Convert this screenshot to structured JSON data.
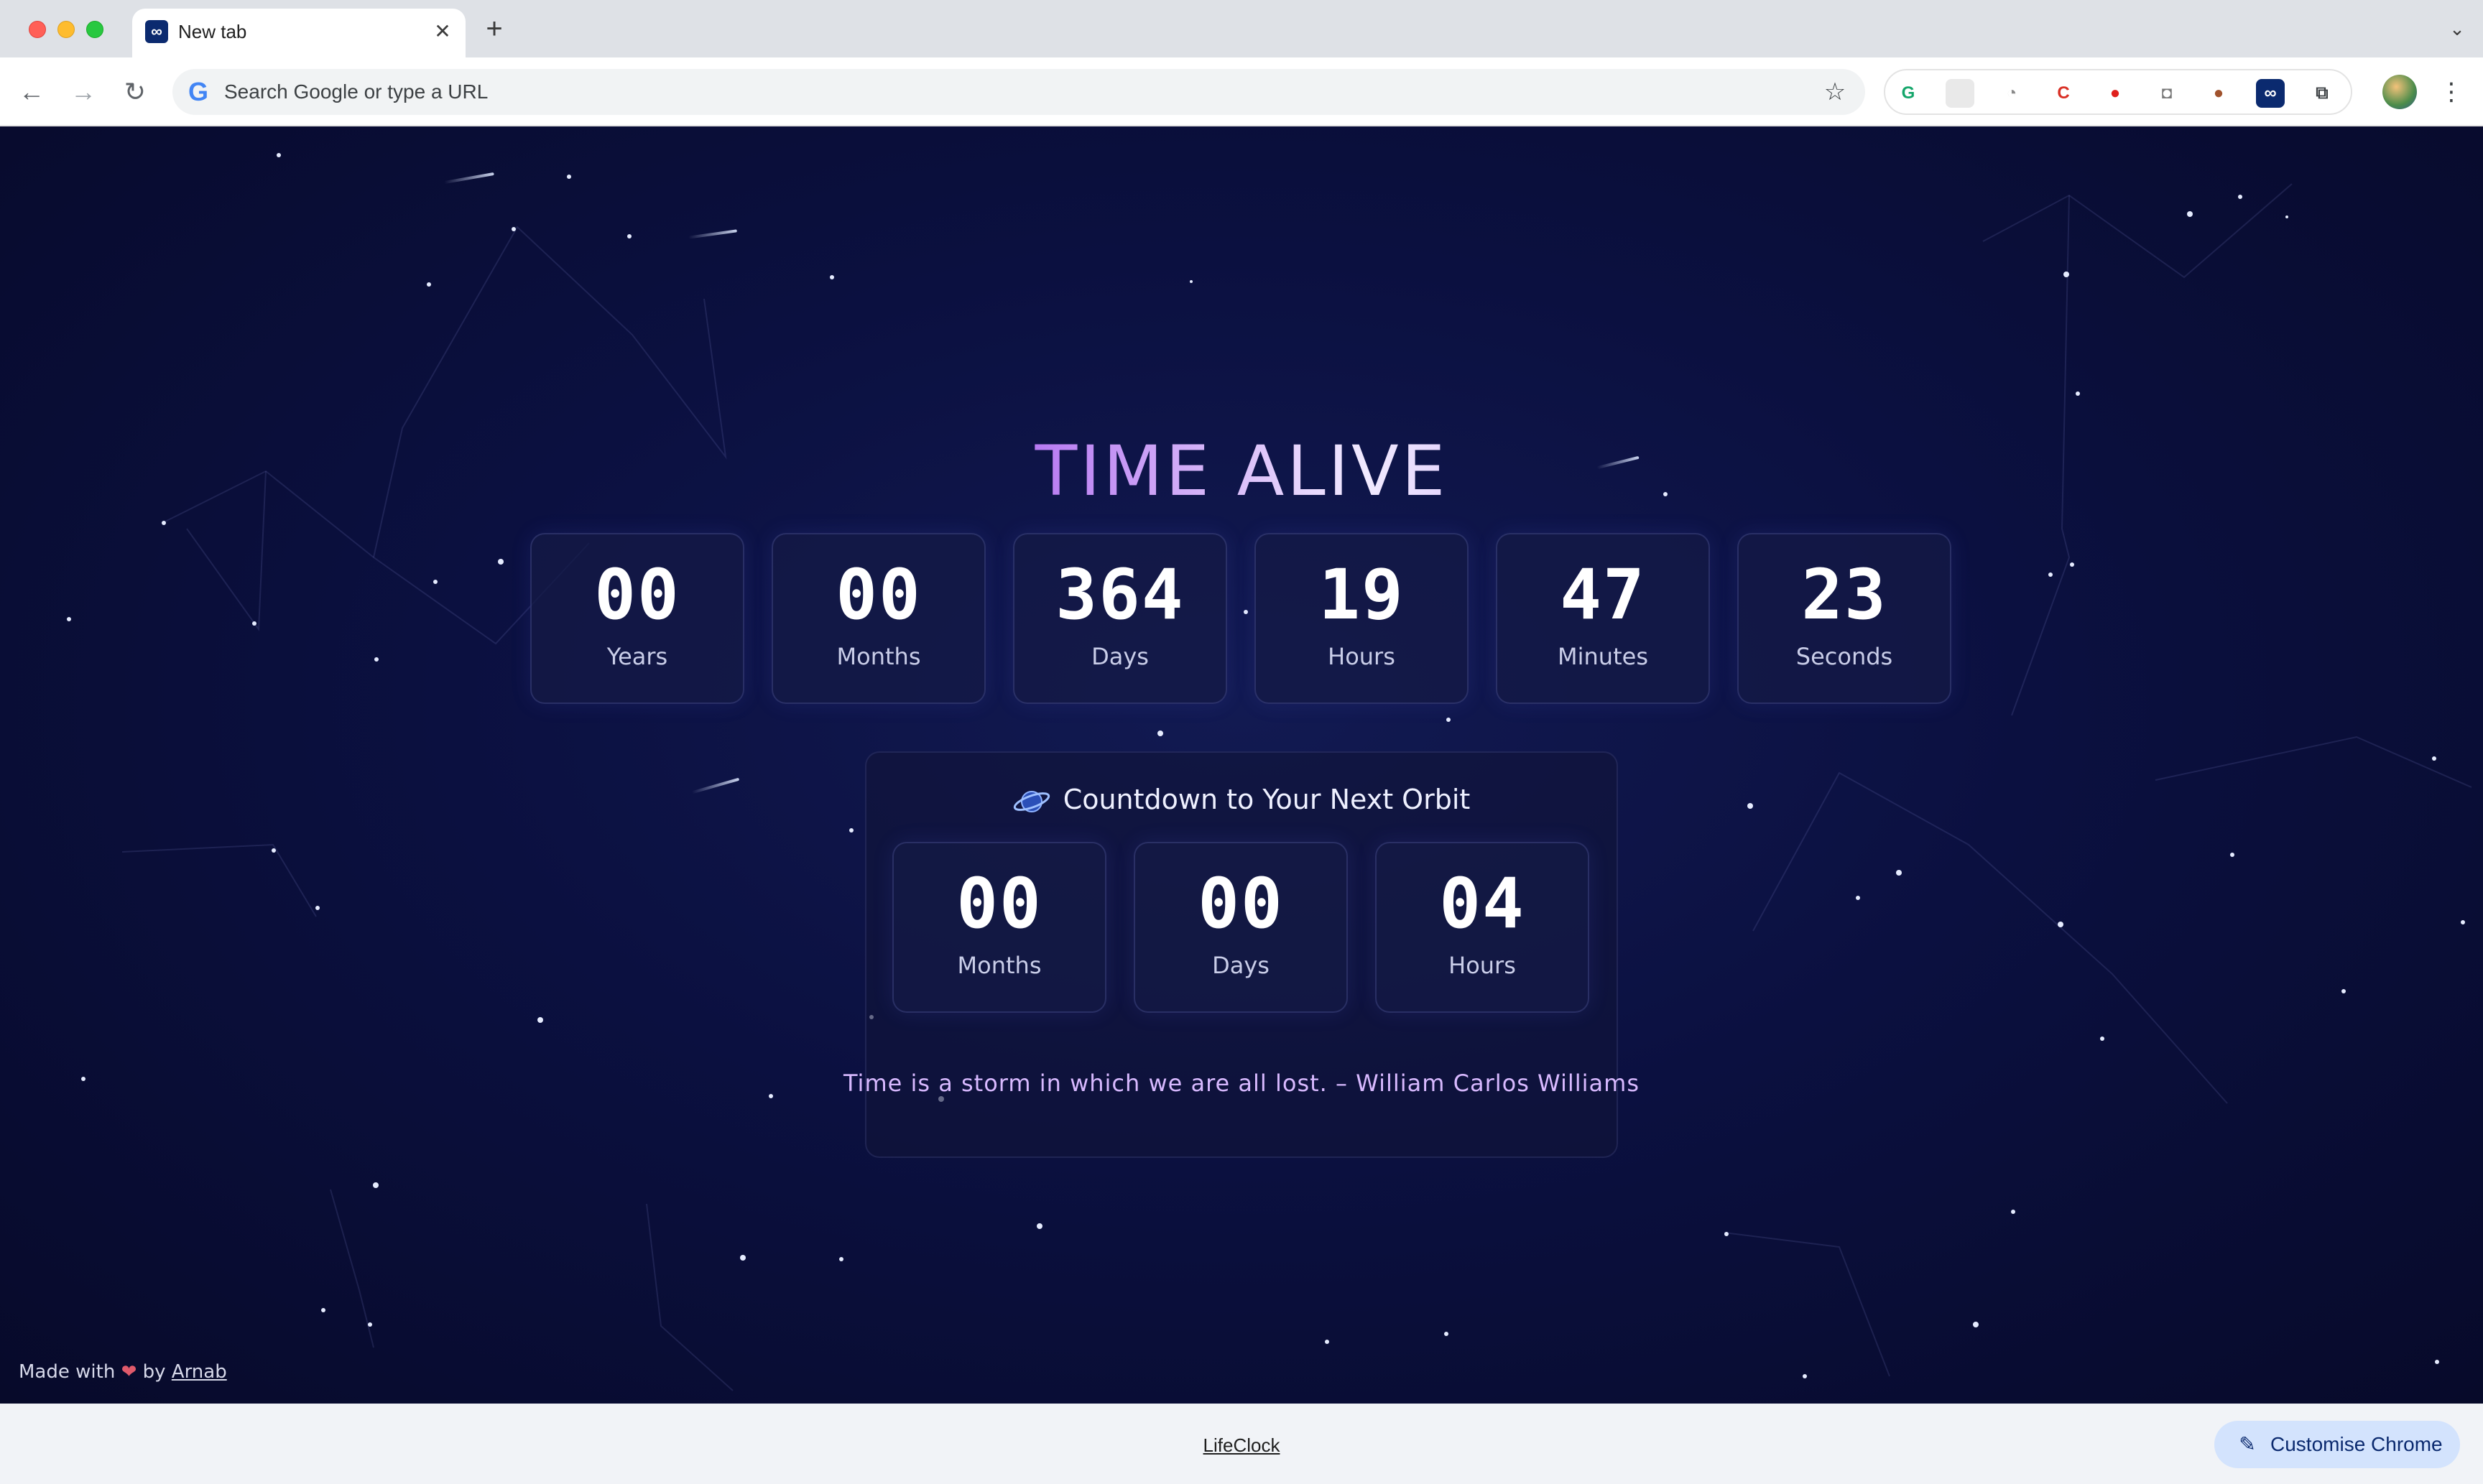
{
  "browser": {
    "tab_title": "New tab",
    "tab_close": "✕",
    "new_tab": "+",
    "tab_search": "⌄",
    "omnibox_placeholder": "Search Google or type a URL",
    "extensions": [
      "grammarly-icon",
      "blank-extension-icon",
      "clock-extension-icon",
      "code-extension-icon",
      "opera-icon",
      "camera-icon",
      "cookie-icon",
      "lifeclock-icon",
      "puzzle-icon"
    ]
  },
  "app": {
    "title": "TIME ALIVE",
    "elapsed": [
      {
        "value": "00",
        "label": "Years"
      },
      {
        "value": "00",
        "label": "Months"
      },
      {
        "value": "364",
        "label": "Days"
      },
      {
        "value": "19",
        "label": "Hours"
      },
      {
        "value": "47",
        "label": "Minutes"
      },
      {
        "value": "23",
        "label": "Seconds"
      }
    ],
    "countdown": {
      "heading": "Countdown to Your Next Orbit",
      "items": [
        {
          "value": "00",
          "label": "Months"
        },
        {
          "value": "00",
          "label": "Days"
        },
        {
          "value": "04",
          "label": "Hours"
        }
      ]
    },
    "quote": "Time is a storm in which we are all lost. – William Carlos Williams",
    "footer_credit": {
      "prefix": "Made with",
      "heart": "❤",
      "by": "by",
      "author": "Arnab"
    }
  },
  "ntp_footer": {
    "link": "LifeClock",
    "customise_label": "Customise Chrome"
  },
  "colors": {
    "background": "#0b1040",
    "title_gradient_start": "#6f63f5",
    "title_gradient_mid": "#f1eaff",
    "quote": "#d8b9ff",
    "customise_bg": "#d3e3fd"
  }
}
